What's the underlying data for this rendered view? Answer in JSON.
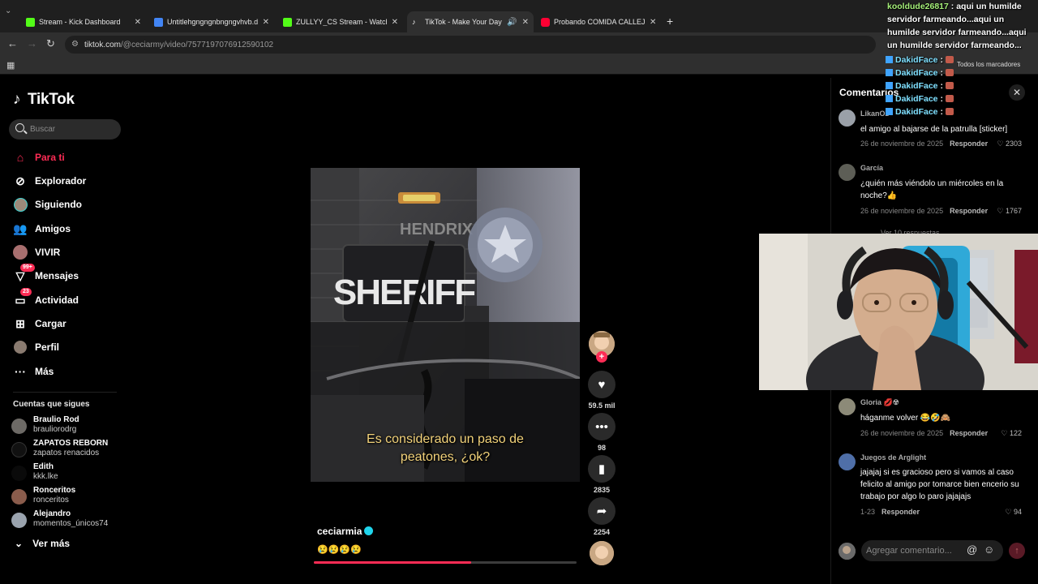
{
  "browser": {
    "tabs": [
      {
        "title": "Stream - Kick Dashboard",
        "color": "#53fc18",
        "active": false
      },
      {
        "title": "Untitlehgngngnbngngvhvb.d.g",
        "color": "#4285f4",
        "active": false
      },
      {
        "title": "ZULLYY_CS Stream - Watch Live",
        "color": "#53fc18",
        "active": false
      },
      {
        "title": "TikTok - Make Your Day",
        "color": "#ffffff",
        "active": true
      },
      {
        "title": "Probando COMIDA CALLEJERA",
        "color": "#ff0033",
        "active": false
      }
    ],
    "url_host": "tiktok.com",
    "url_path": "/@ceciarmy/video/7577197076912590102",
    "all_bookmarks": "Todos los marcadores"
  },
  "tiktok": {
    "logo": "TikTok",
    "search_placeholder": "Buscar",
    "nav": [
      {
        "label": "Para ti",
        "icon": "home-icon",
        "selected": true
      },
      {
        "label": "Explorador",
        "icon": "compass-icon",
        "selected": false
      },
      {
        "label": "Siguiendo",
        "icon": "following-icon",
        "selected": false
      },
      {
        "label": "Amigos",
        "icon": "friends-icon",
        "selected": false
      },
      {
        "label": "VIVIR",
        "icon": "live-icon",
        "selected": false
      },
      {
        "label": "Mensajes",
        "icon": "messages-icon",
        "selected": false,
        "badge": "99+"
      },
      {
        "label": "Actividad",
        "icon": "activity-icon",
        "selected": false,
        "badge": "23"
      },
      {
        "label": "Cargar",
        "icon": "upload-icon",
        "selected": false
      },
      {
        "label": "Perfil",
        "icon": "profile-icon",
        "selected": false
      },
      {
        "label": "Más",
        "icon": "more-dots-icon",
        "selected": false
      }
    ],
    "following_header": "Cuentas que sigues",
    "following": [
      {
        "name": "Braulio Rod",
        "handle": "brauliorodrg"
      },
      {
        "name": "ZAPATOS REBORN",
        "handle": "zapatos renacidos"
      },
      {
        "name": "Edith",
        "handle": "kkk.lke"
      },
      {
        "name": "Ronceritos",
        "handle": "ronceritos"
      },
      {
        "name": "Alejandro",
        "handle": "momentos_únicos74"
      }
    ],
    "see_more": "Ver más"
  },
  "video": {
    "patch_text": "SHERIFF",
    "name_text": "HENDRIX",
    "caption_line1": "Es considerado un paso de",
    "caption_line2": "peatones, ¿ok?",
    "author": "ceciarmia",
    "description": "😢😢😢😢",
    "progress_fraction": 0.6
  },
  "actions": {
    "likes": "59.5 mil",
    "comments": "98",
    "saves": "2835",
    "shares": "2254"
  },
  "comments_panel": {
    "title": "Comentarios",
    "comments": [
      {
        "user": "LikanOz",
        "text": "el amigo al bajarse de la patrulla [sticker]",
        "date": "26 de noviembre de 2025",
        "reply": "Responder",
        "likes": "2303"
      },
      {
        "user": "García",
        "text": "¿quién más viéndolo un miércoles en la noche?👍",
        "date": "26 de noviembre de 2025",
        "reply": "Responder",
        "likes": "1767"
      },
      {
        "user": "Gloria 💋☢",
        "text": "háganme volver 😂🤣🙈",
        "date": "26 de noviembre de 2025",
        "reply": "Responder",
        "likes": "122"
      },
      {
        "user": "Juegos de Arglight",
        "text": "jajajaj si es gracioso pero si vamos al caso felicito al amigo por tomarce bien encerio su trabajo por algo lo paro jajajajs",
        "date": "1-23",
        "reply": "Responder",
        "likes": "94"
      }
    ],
    "view_replies": "Ver 10 respuestas",
    "input_placeholder": "Agregar comentario..."
  },
  "stream_chat": [
    {
      "user": "kooldude26817",
      "message": "aqui un humilde servidor farmeando...aqui un humilde servidor farmeando...aqui un humilde servidor farmeando..."
    },
    {
      "user": "DakidFace",
      "message": ""
    },
    {
      "user": "DakidFace",
      "message": ""
    },
    {
      "user": "DakidFace",
      "message": ""
    },
    {
      "user": "DakidFace",
      "message": ""
    },
    {
      "user": "DakidFace",
      "message": ""
    }
  ]
}
